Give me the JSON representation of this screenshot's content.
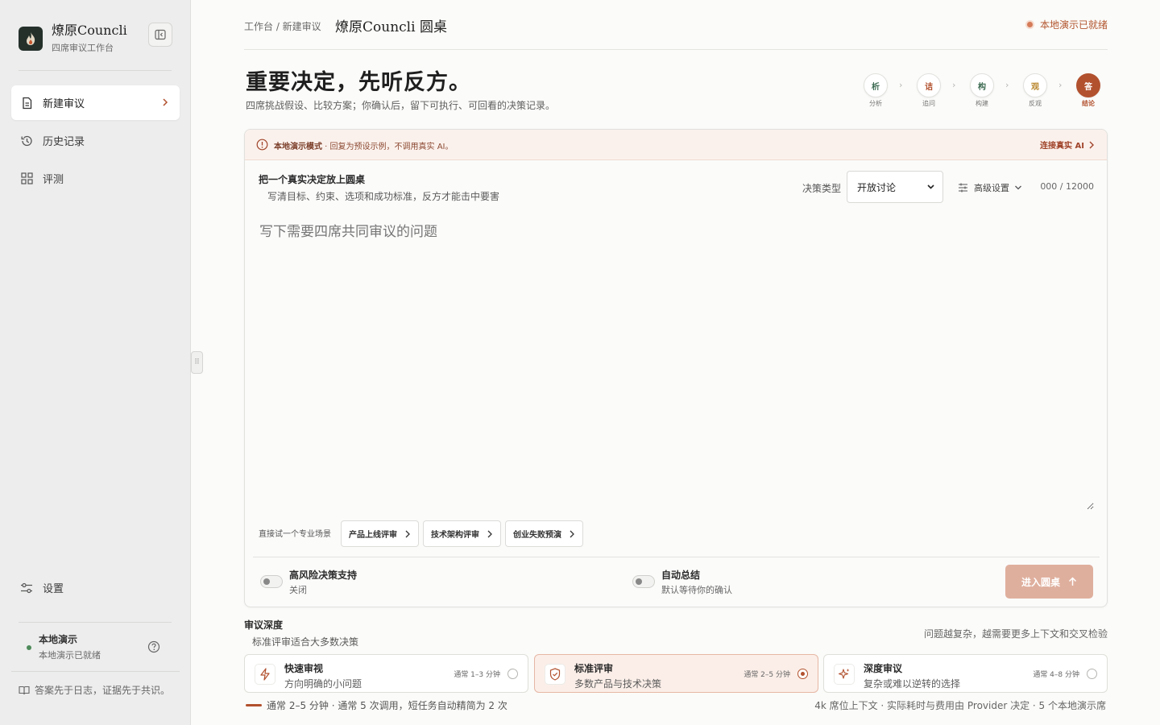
{
  "brand": {
    "title": "燎原Councli",
    "subtitle": "四席审议工作台"
  },
  "sidebar": {
    "items": [
      {
        "label": "新建审议",
        "icon": "document-icon",
        "active": true
      },
      {
        "label": "历史记录",
        "icon": "history-icon"
      },
      {
        "label": "评测",
        "icon": "grid-icon"
      }
    ],
    "settings_label": "设置",
    "status": {
      "title": "本地演示",
      "subtitle": "本地演示已就绪"
    },
    "motto": "答案先于日志，证据先于共识。"
  },
  "topbar": {
    "breadcrumb": "工作台 / 新建审议",
    "title": "燎原Councli 圆桌",
    "status": "本地演示已就绪"
  },
  "hero": {
    "headline": "重要决定，先听反方。",
    "subline": "四席挑战假设、比较方案；你确认后，留下可执行、可回看的决策记录。"
  },
  "steps": [
    {
      "glyph": "析",
      "label": "分析",
      "color": "#3d6b52"
    },
    {
      "glyph": "诘",
      "label": "追问",
      "color": "#b2512e"
    },
    {
      "glyph": "构",
      "label": "构建",
      "color": "#3d6b52"
    },
    {
      "glyph": "观",
      "label": "反观",
      "color": "#b8862c"
    },
    {
      "glyph": "答",
      "label": "结论",
      "color": "#ffffff"
    }
  ],
  "composer": {
    "banner_title": "本地演示模式",
    "banner_text": " · 回复为预设示例，不调用真实 AI。",
    "banner_link": "连接真实 AI",
    "heading": "把一个真实决定放上圆桌",
    "subheading": "写清目标、约束、选项和成功标准，反方才能击中要害",
    "decision_type_label": "决策类型",
    "decision_type_value": "开放讨论",
    "advanced_label": "高级设置",
    "counter": "000 / 12000",
    "placeholder": "写下需要四席共同审议的问题",
    "scenario_label": "直接试一个专业场景",
    "scenarios": [
      "产品上线评审",
      "技术架构评审",
      "创业失败预演"
    ],
    "toggle_risk_title": "高风险决策支持",
    "toggle_risk_sub": "关闭",
    "toggle_summary_title": "自动总结",
    "toggle_summary_sub": "默认等待你的确认",
    "enter_label": "进入圆桌"
  },
  "depth": {
    "title": "审议深度",
    "subtitle": "标准评审适合大多数决策",
    "note": "问题越复杂，越需要更多上下文和交叉检验",
    "options": [
      {
        "title": "快速审视",
        "sub": "方向明确的小问题",
        "time": "通常 1–3 分钟",
        "icon": "lightning-icon",
        "selected": false
      },
      {
        "title": "标准评审",
        "sub": "多数产品与技术决策",
        "time": "通常 2–5 分钟",
        "icon": "shield-icon",
        "selected": true
      },
      {
        "title": "深度审议",
        "sub": "复杂或难以逆转的选择",
        "time": "通常 4–8 分钟",
        "icon": "sparkle-icon",
        "selected": false
      }
    ],
    "footer_left": "通常 2–5 分钟 · 通常 5 次调用，短任务自动精简为 2 次",
    "footer_right": "4k 席位上下文 · 实际耗时与费用由 Provider 决定 · 5 个本地演示席"
  },
  "colors": {
    "accent": "#b2512e",
    "sidebar_bg": "#ecedec",
    "logo_bg": "#25302b"
  }
}
